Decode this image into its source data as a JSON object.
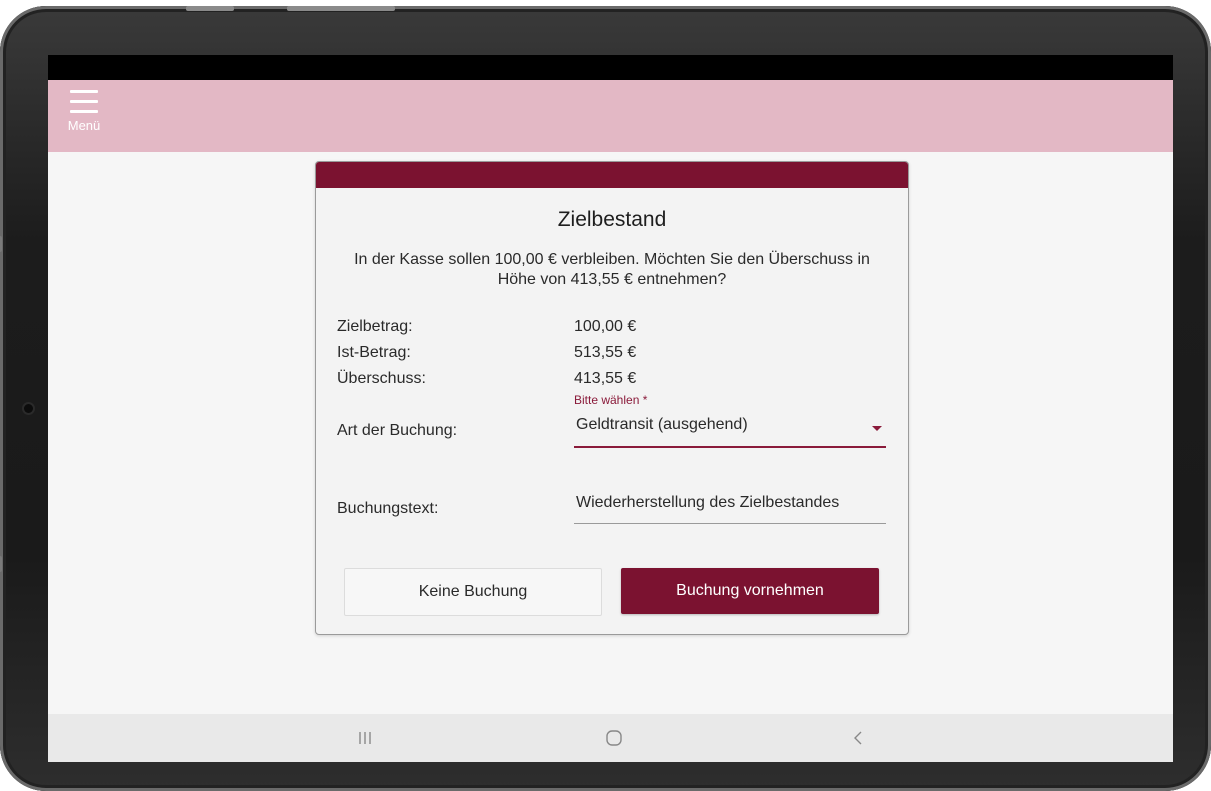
{
  "appbar": {
    "menu_label": "Menü"
  },
  "dialog": {
    "title": "Zielbestand",
    "message": "In der Kasse sollen 100,00 € verbleiben. Möchten Sie den Überschuss in Höhe von 413,55 € entnehmen?",
    "rows": [
      {
        "label": "Zielbetrag:",
        "value": "100,00 €"
      },
      {
        "label": "Ist-Betrag:",
        "value": "513,55 €"
      },
      {
        "label": "Überschuss:",
        "value": "413,55 €"
      }
    ],
    "booking_type": {
      "label": "Art der Buchung:",
      "hint": "Bitte wählen *",
      "selected": "Geldtransit (ausgehend)"
    },
    "booking_text": {
      "label": "Buchungstext:",
      "value": "Wiederherstellung des Zielbestandes"
    },
    "buttons": {
      "no_booking": "Keine Buchung",
      "book": "Buchung vornehmen"
    }
  },
  "navbar": {
    "items": [
      "recents-icon",
      "home-icon",
      "back-icon"
    ]
  },
  "colors": {
    "primary": "#7b1230",
    "appbar": "#e3b8c5",
    "screen_bg": "#f6f6f6"
  }
}
